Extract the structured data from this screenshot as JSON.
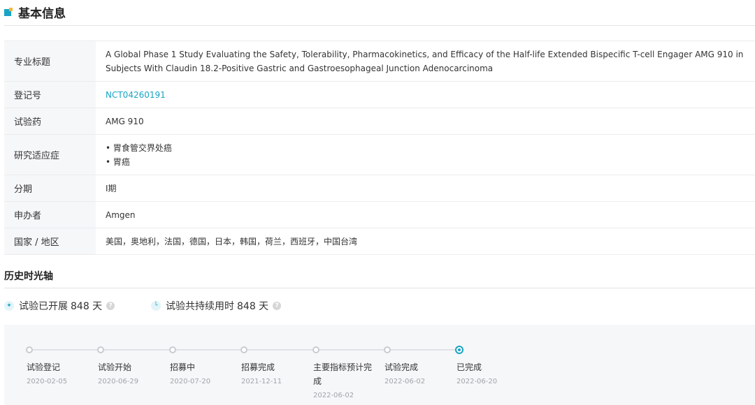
{
  "section": {
    "title": "基本信息"
  },
  "info": {
    "rows": [
      {
        "label": "专业标题",
        "value": "A Global Phase 1 Study Evaluating the Safety, Tolerability, Pharmacokinetics, and Efficacy of the Half-life Extended Bispecific T-cell Engager AMG 910 in Subjects With Claudin 18.2-Positive Gastric and Gastroesophageal Junction Adenocarcinoma"
      },
      {
        "label": "登记号",
        "value": "NCT04260191"
      },
      {
        "label": "试验药",
        "value": "AMG 910"
      },
      {
        "label": "研究适应症",
        "items": [
          "• 胃食管交界处癌",
          "• 胃癌"
        ]
      },
      {
        "label": "分期",
        "value": "I期"
      },
      {
        "label": "申办者",
        "value": "Amgen"
      },
      {
        "label": "国家 / 地区",
        "value": "美国，奥地利，法国，德国，日本，韩国，荷兰，西班牙，中国台湾"
      }
    ]
  },
  "history": {
    "title": "历史时光轴",
    "stat_started": {
      "label": "试验已开展",
      "value": "848 天",
      "icon": "pill-icon"
    },
    "stat_duration": {
      "label": "试验共持续用时",
      "value": "848 天",
      "icon": "clock-icon"
    },
    "help_glyph": "?",
    "steps": [
      {
        "label": "试验登记",
        "date": "2020-02-05"
      },
      {
        "label": "试验开始",
        "date": "2020-06-29"
      },
      {
        "label": "招募中",
        "date": "2020-07-20"
      },
      {
        "label": "招募完成",
        "date": "2021-12-11"
      },
      {
        "label": "主要指标预计完成",
        "date": "2022-06-02"
      },
      {
        "label": "试验完成",
        "date": "2022-06-02"
      },
      {
        "label": "已完成",
        "date": "2022-06-20"
      }
    ]
  },
  "colors": {
    "accent": "#18a4c4",
    "accent_secondary": "#f6b63d",
    "label_bg": "#f6f7f9",
    "date_text": "#a0a4a9"
  }
}
